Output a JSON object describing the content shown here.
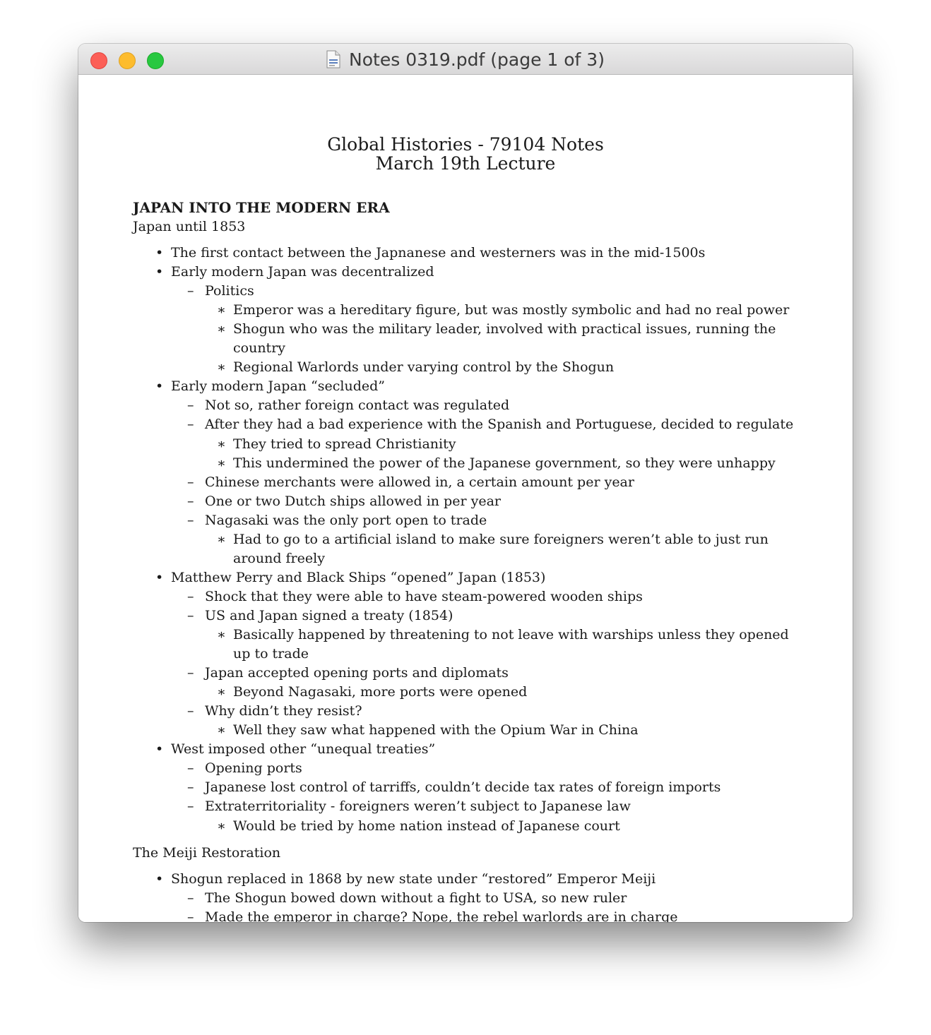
{
  "window": {
    "title": "Notes 0319.pdf (page 1 of 3)",
    "icon": "pdf-document-icon",
    "controls": [
      "close",
      "minimize",
      "zoom"
    ]
  },
  "document": {
    "title_line1": "Global Histories - 79104 Notes",
    "title_line2": "March 19th Lecture",
    "section_heading": "JAPAN INTO THE MODERN ERA",
    "subsection1": "Japan until 1853",
    "subsection2": "The Meiji Restoration",
    "lines": [
      {
        "level": 1,
        "text": "The first contact between the Japnanese and westerners was in the mid-1500s"
      },
      {
        "level": 1,
        "text": "Early modern Japan was decentralized"
      },
      {
        "level": 2,
        "text": "Politics"
      },
      {
        "level": 3,
        "text": "Emperor was a hereditary figure, but was mostly symbolic and had no real power"
      },
      {
        "level": 3,
        "text": "Shogun who was the military leader, involved with practical issues, running the"
      },
      {
        "level": 0,
        "text": "country"
      },
      {
        "level": 3,
        "text": "Regional Warlords under varying control by the Shogun"
      },
      {
        "level": 1,
        "text": "Early modern Japan “secluded”"
      },
      {
        "level": 2,
        "text": "Not so, rather foreign contact was regulated"
      },
      {
        "level": 2,
        "text": "After they had a bad experience with the Spanish and Portuguese, decided to regulate"
      },
      {
        "level": 3,
        "text": "They tried to spread Christianity"
      },
      {
        "level": 3,
        "text": "This undermined the power of the Japanese government, so they were unhappy"
      },
      {
        "level": 2,
        "text": "Chinese merchants were allowed in, a certain amount per year"
      },
      {
        "level": 2,
        "text": "One or two Dutch ships allowed in per year"
      },
      {
        "level": 2,
        "text": "Nagasaki was the only port open to trade"
      },
      {
        "level": 3,
        "text": "Had to go to a artificial island to make sure foreigners weren’t able to just run"
      },
      {
        "level": 0,
        "text": "around freely"
      },
      {
        "level": 1,
        "text": "Matthew Perry and Black Ships “opened” Japan (1853)"
      },
      {
        "level": 2,
        "text": "Shock that they were able to have steam-powered wooden ships"
      },
      {
        "level": 2,
        "text": "US and Japan signed a treaty (1854)"
      },
      {
        "level": 3,
        "text": "Basically happened by threatening to not leave with warships unless they opened"
      },
      {
        "level": 0,
        "text": "up to trade"
      },
      {
        "level": 2,
        "text": "Japan accepted opening ports and diplomats"
      },
      {
        "level": 3,
        "text": "Beyond Nagasaki, more ports were opened"
      },
      {
        "level": 2,
        "text": "Why didn’t they resist?"
      },
      {
        "level": 3,
        "text": "Well they saw what happened with the Opium War in China"
      },
      {
        "level": 1,
        "text": "West imposed other “unequal treaties”"
      },
      {
        "level": 2,
        "text": "Opening ports"
      },
      {
        "level": 2,
        "text": "Japanese lost control of tarriffs, couldn’t decide tax rates of foreign imports"
      },
      {
        "level": 2,
        "text": "Extraterritoriality - foreigners weren’t subject to Japanese law"
      },
      {
        "level": 3,
        "text": "Would be tried by home nation instead of Japanese court"
      }
    ],
    "lines2": [
      {
        "level": 1,
        "text": "Shogun replaced in 1868 by new state under “restored” Emperor Meiji"
      },
      {
        "level": 2,
        "text": "The Shogun bowed down without a fight to USA, so new ruler"
      },
      {
        "level": 2,
        "text": "Made the emperor in charge? Nope, the rebel warlords are in charge"
      }
    ]
  }
}
